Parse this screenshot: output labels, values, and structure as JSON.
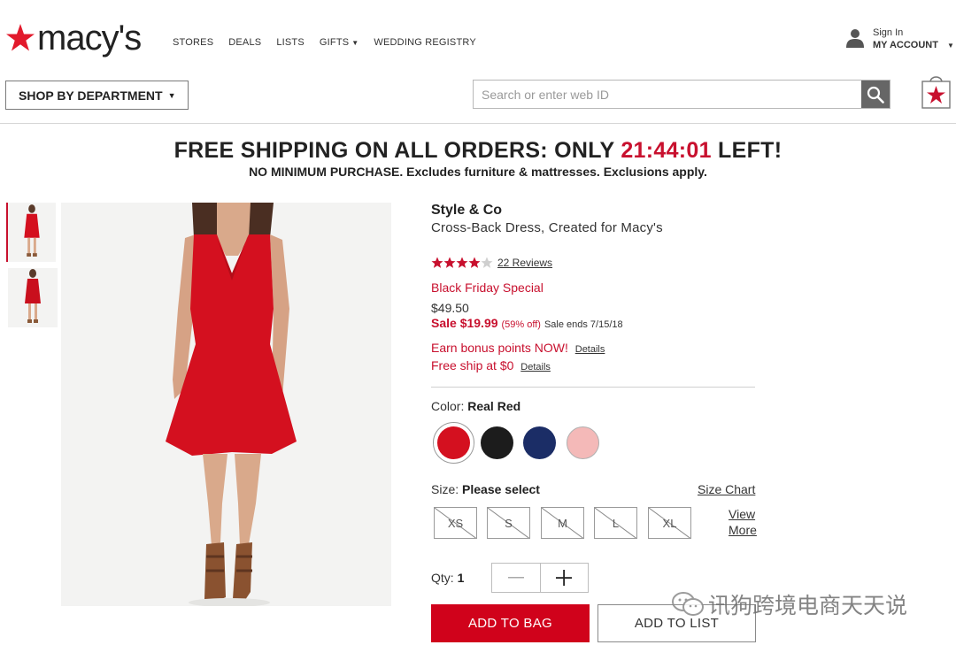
{
  "header": {
    "logo_text": "macy's",
    "nav": [
      "STORES",
      "DEALS",
      "LISTS",
      "GIFTS",
      "WEDDING REGISTRY"
    ],
    "account": {
      "sign_in": "Sign In",
      "my_account": "MY ACCOUNT"
    },
    "shop_by_department": "SHOP BY DEPARTMENT",
    "search_placeholder": "Search or enter web ID"
  },
  "promo": {
    "headline_before": "FREE SHIPPING ON ALL ORDERS: ONLY ",
    "timer": "21:44:01",
    "headline_after": " LEFT!",
    "subline": "NO MINIMUM PURCHASE. Excludes furniture & mattresses. Exclusions apply."
  },
  "product": {
    "brand": "Style & Co",
    "name": "Cross-Back Dress, Created for Macy's",
    "rating": 4,
    "rating_max": 5,
    "reviews": "22 Reviews",
    "special": "Black Friday Special",
    "original_price": "$49.50",
    "sale_price": "Sale $19.99",
    "sale_off": "(59% off)",
    "sale_ends": "Sale ends 7/15/18",
    "bonus": "Earn bonus points NOW!",
    "free_ship": "Free ship at $0",
    "details_link": "Details",
    "color_label": "Color:",
    "color_value": "Real Red",
    "colors": [
      "#d4101f",
      "#1c1c1c",
      "#1b2d66",
      "#f4b9b8"
    ],
    "size_label": "Size:",
    "size_value": "Please select",
    "size_chart": "Size Chart",
    "sizes": [
      "XS",
      "S",
      "M",
      "L",
      "XL"
    ],
    "view": "View",
    "more": "More",
    "qty_label": "Qty:",
    "qty_value": "1",
    "add_to_bag": "ADD TO BAG",
    "add_to_list": "ADD TO LIST"
  },
  "watermark": "讯狗跨境电商天天说",
  "colors": {
    "brand_red": "#c8102e",
    "button_red": "#d0021b"
  }
}
